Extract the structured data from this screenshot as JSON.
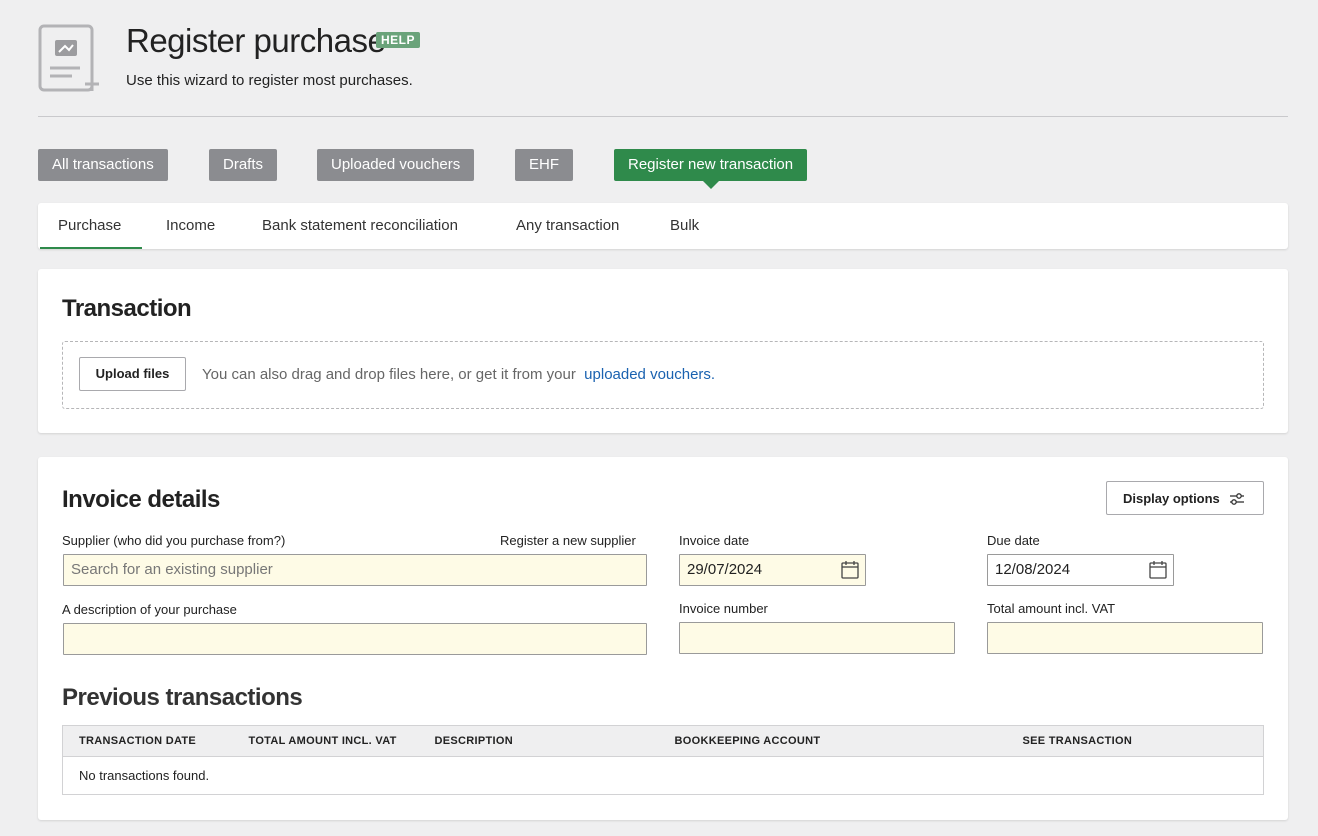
{
  "header": {
    "title": "Register purchase",
    "help_badge": "HELP",
    "subtitle": "Use this wizard to register most purchases."
  },
  "nav_pills": [
    {
      "label": "All transactions"
    },
    {
      "label": "Drafts"
    },
    {
      "label": "Uploaded vouchers"
    },
    {
      "label": "EHF"
    },
    {
      "label": "Register new transaction",
      "active": true
    }
  ],
  "tabs": [
    {
      "label": "Purchase",
      "active": true
    },
    {
      "label": "Income"
    },
    {
      "label": "Bank statement reconciliation"
    },
    {
      "label": "Any transaction"
    },
    {
      "label": "Bulk"
    }
  ],
  "transaction_card": {
    "title": "Transaction",
    "upload_button": "Upload files",
    "dropzone_text": "You can also drag and drop files here, or get it from your",
    "dropzone_link": "uploaded vouchers."
  },
  "invoice_card": {
    "title": "Invoice details",
    "display_options": "Display options",
    "supplier": {
      "label": "Supplier (who did you purchase from?)",
      "register_link": "Register a new supplier",
      "placeholder": "Search for an existing supplier",
      "value": ""
    },
    "invoice_date": {
      "label": "Invoice date",
      "value": "29/07/2024"
    },
    "due_date": {
      "label": "Due date",
      "value": "12/08/2024"
    },
    "description": {
      "label": "A description of your purchase",
      "value": ""
    },
    "invoice_number": {
      "label": "Invoice number",
      "value": ""
    },
    "total_amount": {
      "label": "Total amount incl. VAT",
      "value": ""
    }
  },
  "previous_transactions": {
    "title": "Previous transactions",
    "columns": [
      "TRANSACTION DATE",
      "TOTAL AMOUNT INCL. VAT",
      "DESCRIPTION",
      "BOOKKEEPING ACCOUNT",
      "SEE TRANSACTION"
    ],
    "empty_message": "No transactions found."
  },
  "colors": {
    "accent_green": "#2f8a4b",
    "pill_gray": "#8b8c90",
    "input_bg": "#fefbe6",
    "link_blue": "#1a62b0"
  }
}
